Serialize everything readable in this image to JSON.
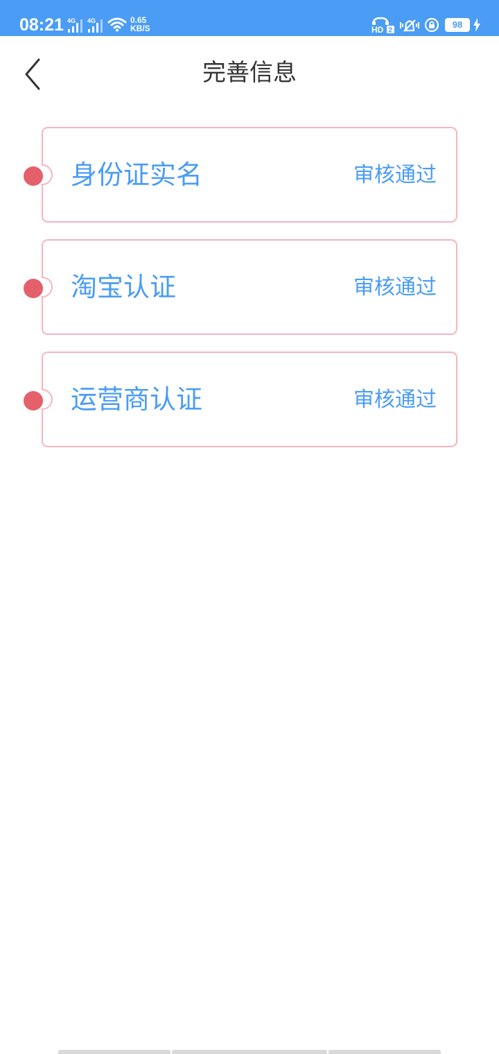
{
  "status_bar": {
    "time": "08:21",
    "network_1": "4G",
    "network_2": "4G",
    "speed_value": "0.65",
    "speed_unit": "KB/S",
    "hd_label": "HD",
    "hd_sub": "2",
    "battery": "98",
    "icons": [
      "signal-icon",
      "wifi-icon",
      "hd-voice-icon",
      "vibrate-icon",
      "rotation-lock-icon",
      "battery-icon",
      "charging-icon"
    ]
  },
  "header": {
    "title": "完善信息",
    "back_icon": "chevron-left-icon"
  },
  "colors": {
    "status_bar_bg": "#4a9cf5",
    "accent": "#4a9cf5",
    "card_border": "#f5b4c0",
    "dot": "#e4606a"
  },
  "cards": [
    {
      "title": "身份证实名",
      "status": "审核通过"
    },
    {
      "title": "淘宝认证",
      "status": "审核通过"
    },
    {
      "title": "运营商认证",
      "status": "审核通过"
    }
  ]
}
